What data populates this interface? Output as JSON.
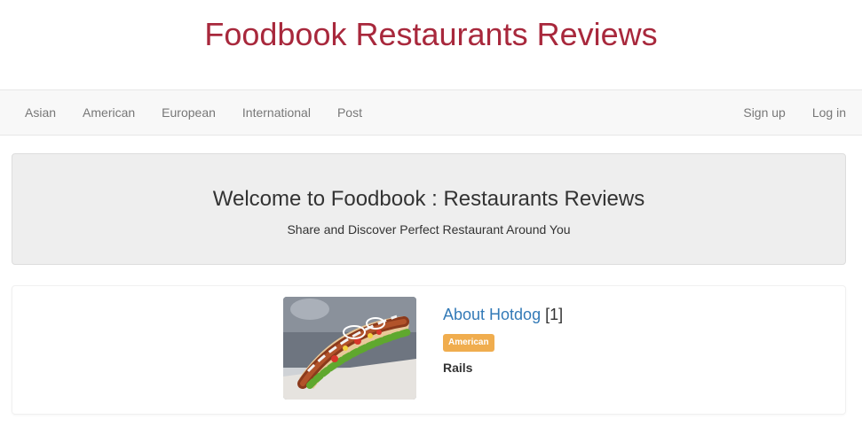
{
  "site": {
    "title": "Foodbook Restaurants Reviews"
  },
  "nav": {
    "left": [
      "Asian",
      "American",
      "European",
      "International",
      "Post"
    ],
    "right": [
      "Sign up",
      "Log in"
    ]
  },
  "jumbotron": {
    "title": "Welcome to Foodbook : Restaurants Reviews",
    "subtitle": "Share and Discover Perfect Restaurant Around You"
  },
  "post": {
    "title": "About Hotdog",
    "count": "[1]",
    "category": "American",
    "author": "Rails",
    "image_icon": "hotdog-photo"
  },
  "colors": {
    "title": "#a8283c",
    "link": "#337ab7",
    "badge": "#f0ad4e",
    "navbar_bg": "#f8f8f8",
    "jumbotron_bg": "#eeeeee"
  }
}
